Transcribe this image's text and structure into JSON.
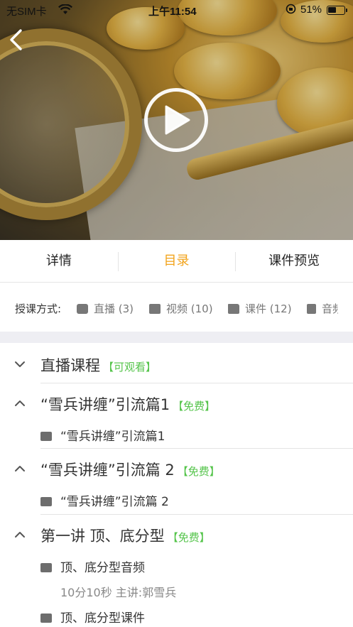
{
  "status_bar": {
    "carrier": "无SIM卡",
    "time": "上午11:54",
    "battery": "51%",
    "battery_level": 0.51
  },
  "tabs": [
    {
      "label": "详情",
      "active": false
    },
    {
      "label": "目录",
      "active": true
    },
    {
      "label": "课件预览",
      "active": false
    }
  ],
  "teaching_modes": {
    "label": "授课方式:",
    "items": [
      {
        "icon": "live-icon",
        "label": "直播 (3)"
      },
      {
        "icon": "video-icon",
        "label": "视频 (10)"
      },
      {
        "icon": "folder-icon",
        "label": "课件 (12)"
      },
      {
        "icon": "audio-icon",
        "label": "音频"
      }
    ]
  },
  "catalog": [
    {
      "title": "直播课程",
      "tag": "【可观看】",
      "expanded": false,
      "items": []
    },
    {
      "title": "“雪兵讲缠”引流篇1",
      "tag": "【免费】",
      "expanded": true,
      "items": [
        {
          "icon": "folder-icon",
          "label": "“雪兵讲缠”引流篇1"
        }
      ]
    },
    {
      "title": "“雪兵讲缠”引流篇 2",
      "tag": "【免费】",
      "expanded": true,
      "items": [
        {
          "icon": "folder-icon",
          "label": "“雪兵讲缠”引流篇 2"
        }
      ]
    },
    {
      "title": "第一讲 顶、底分型",
      "tag": "【免费】",
      "expanded": true,
      "items": [
        {
          "icon": "video-icon",
          "label": "顶、底分型音频",
          "meta": "10分10秒 主讲:郭雪兵"
        },
        {
          "icon": "folder-icon",
          "label": "顶、底分型课件"
        }
      ]
    }
  ],
  "colors": {
    "accent": "#f2a31a",
    "tag_green": "#55c44b",
    "separator": "#eeeef3"
  }
}
